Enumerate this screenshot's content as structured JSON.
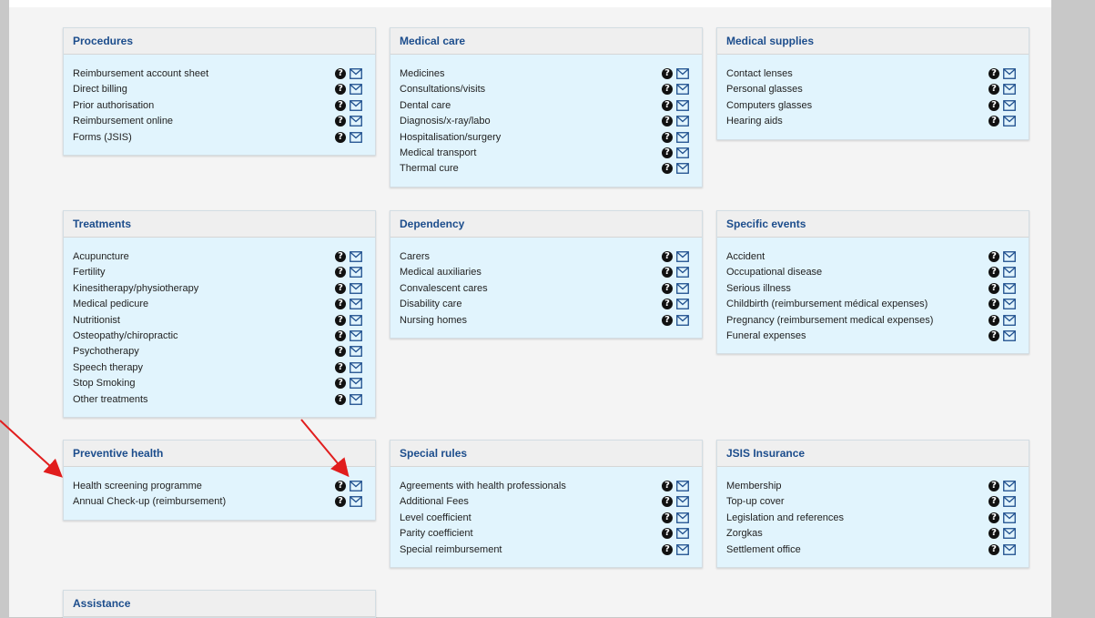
{
  "icons": {
    "help": "question-circle-icon",
    "mail": "envelope-icon"
  },
  "colors": {
    "box_bg": "#e1f4fd",
    "header_text": "#1c4d8c",
    "arrow": "#e11d1d"
  },
  "boxes": [
    {
      "id": "procedures",
      "title": "Procedures",
      "items": [
        "Reimbursement account sheet",
        "Direct billing",
        "Prior authorisation",
        "Reimbursement online",
        "Forms (JSIS)"
      ]
    },
    {
      "id": "medical-care",
      "title": "Medical care",
      "items": [
        "Medicines",
        "Consultations/visits",
        "Dental care",
        "Diagnosis/x-ray/labo",
        "Hospitalisation/surgery",
        "Medical transport",
        "Thermal cure"
      ]
    },
    {
      "id": "medical-supplies",
      "title": "Medical supplies",
      "items": [
        "Contact lenses",
        "Personal glasses",
        "Computers glasses",
        "Hearing aids"
      ]
    },
    {
      "id": "treatments",
      "title": "Treatments",
      "items": [
        "Acupuncture",
        "Fertility",
        "Kinesitherapy/physiotherapy",
        "Medical pedicure",
        "Nutritionist",
        "Osteopathy/chiropractic",
        "Psychotherapy",
        "Speech therapy",
        "Stop Smoking",
        "Other treatments"
      ]
    },
    {
      "id": "dependency",
      "title": "Dependency",
      "items": [
        "Carers",
        "Medical auxiliaries",
        "Convalescent cares",
        "Disability care",
        "Nursing homes"
      ]
    },
    {
      "id": "specific-events",
      "title": "Specific events",
      "items": [
        "Accident",
        "Occupational disease",
        "Serious illness",
        "Childbirth (reimbursement médical expenses)",
        "Pregnancy (reimbursement medical expenses)",
        "Funeral expenses"
      ]
    },
    {
      "id": "preventive-health",
      "title": "Preventive health",
      "items": [
        "Health screening programme",
        "Annual Check-up (reimbursement)"
      ]
    },
    {
      "id": "special-rules",
      "title": "Special rules",
      "items": [
        "Agreements with health professionals",
        "Additional Fees",
        "Level coefficient",
        "Parity coefficient",
        "Special reimbursement"
      ]
    },
    {
      "id": "jsis-insurance",
      "title": "JSIS Insurance",
      "items": [
        "Membership",
        "Top-up cover",
        "Legislation and references",
        "Zorgkas",
        "Settlement office"
      ]
    },
    {
      "id": "assistance",
      "title": "Assistance",
      "items": []
    }
  ]
}
